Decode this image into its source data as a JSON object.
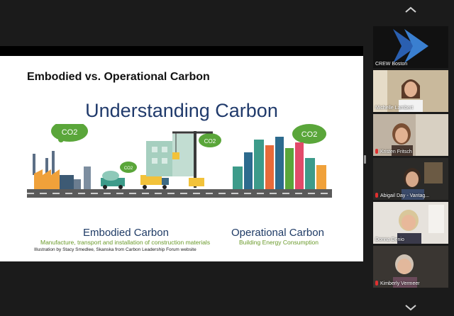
{
  "slide": {
    "heading": "Embodied vs. Operational Carbon",
    "title": "Understanding Carbon",
    "co2_label": "CO2",
    "embodied": {
      "label": "Embodied Carbon",
      "caption": "Manufacture, transport and installation of construction materials"
    },
    "operational": {
      "label": "Operational Carbon",
      "caption": "Building Energy Consumption"
    },
    "credit": "Illustration by Stacy Smedlee, Skanska from Carbon Leadership Forum website"
  },
  "participants": [
    {
      "name": "CREW Boston",
      "muted": false,
      "active": false,
      "type": "logo"
    },
    {
      "name": "Michelle Lambert",
      "muted": false,
      "active": true,
      "type": "video"
    },
    {
      "name": "Kristen Fritsch",
      "muted": true,
      "active": false,
      "type": "video"
    },
    {
      "name": "Abigail Day - Vantag...",
      "muted": true,
      "active": false,
      "type": "video"
    },
    {
      "name": "Donna Denio",
      "muted": false,
      "active": false,
      "type": "video"
    },
    {
      "name": "Kimberly Vermeer",
      "muted": true,
      "active": false,
      "type": "video"
    }
  ],
  "colors": {
    "background": "#1b1b1b",
    "active_speaker_border": "#e8c15a",
    "title_blue": "#203a6b",
    "caption_green": "#6a9a2a",
    "mute_red": "#e03030"
  },
  "icons": [
    "chevron-up-icon",
    "chevron-down-icon",
    "muted-mic-icon"
  ]
}
